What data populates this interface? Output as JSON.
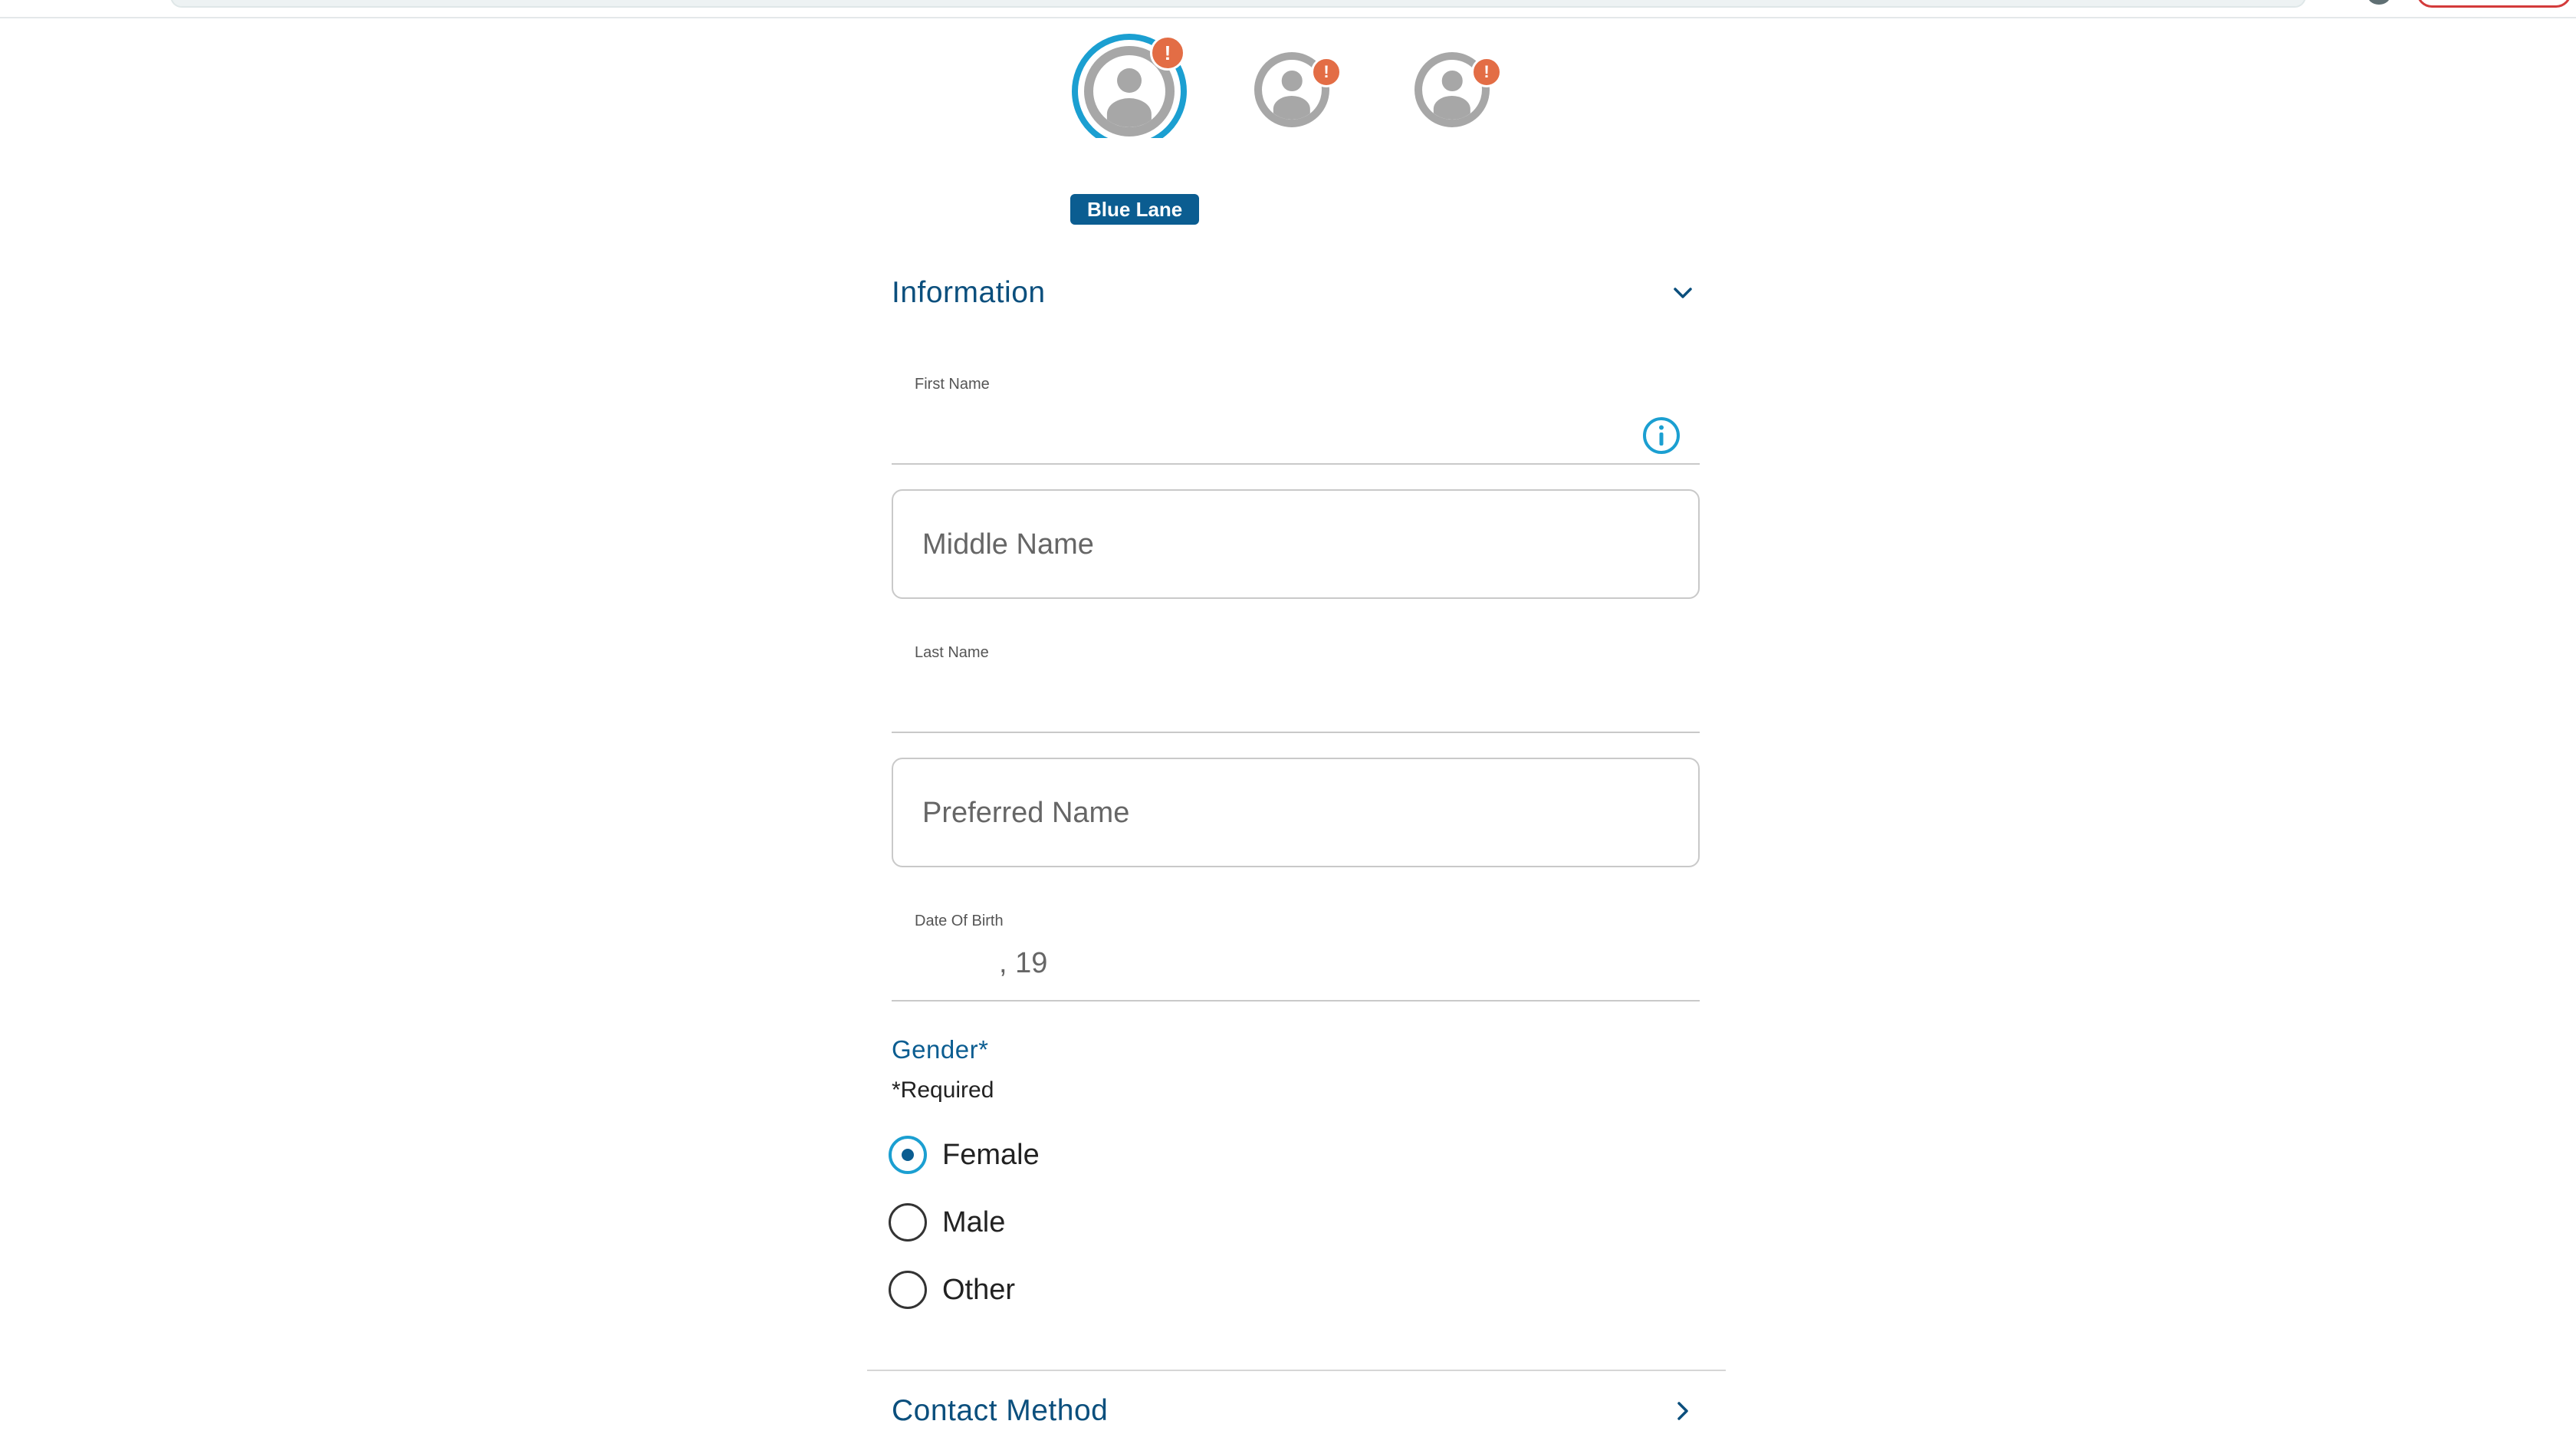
{
  "travelers": [
    {
      "name": "traveler-1",
      "alert": "!",
      "active": true
    },
    {
      "name": "traveler-2",
      "alert": "!",
      "active": false
    },
    {
      "name": "traveler-3",
      "alert": "!",
      "active": false
    }
  ],
  "lane_badge": "Blue Lane",
  "information": {
    "title": "Information",
    "first_name": {
      "label": "First Name",
      "value": ""
    },
    "middle_name": {
      "placeholder": "Middle Name"
    },
    "last_name": {
      "label": "Last Name",
      "value": ""
    },
    "preferred_name": {
      "placeholder": "Preferred Name"
    },
    "dob": {
      "label": "Date Of Birth",
      "value": ", 19"
    }
  },
  "gender": {
    "label": "Gender*",
    "required_note": "*Required",
    "options": [
      "Female",
      "Male",
      "Other"
    ],
    "selected": "Female"
  },
  "contact_method": {
    "title": "Contact Method"
  },
  "colors": {
    "primary_text": "#0b4f7d",
    "accent": "#1b9fd1",
    "badge": "#0b5d91",
    "alert": "#e36d45",
    "avatar_gray": "#a7a7a7"
  },
  "icons": {
    "info": "info-circle-icon",
    "chevron_down": "chevron-down-icon",
    "chevron_right": "chevron-right-icon",
    "avatar": "user-avatar-icon"
  }
}
